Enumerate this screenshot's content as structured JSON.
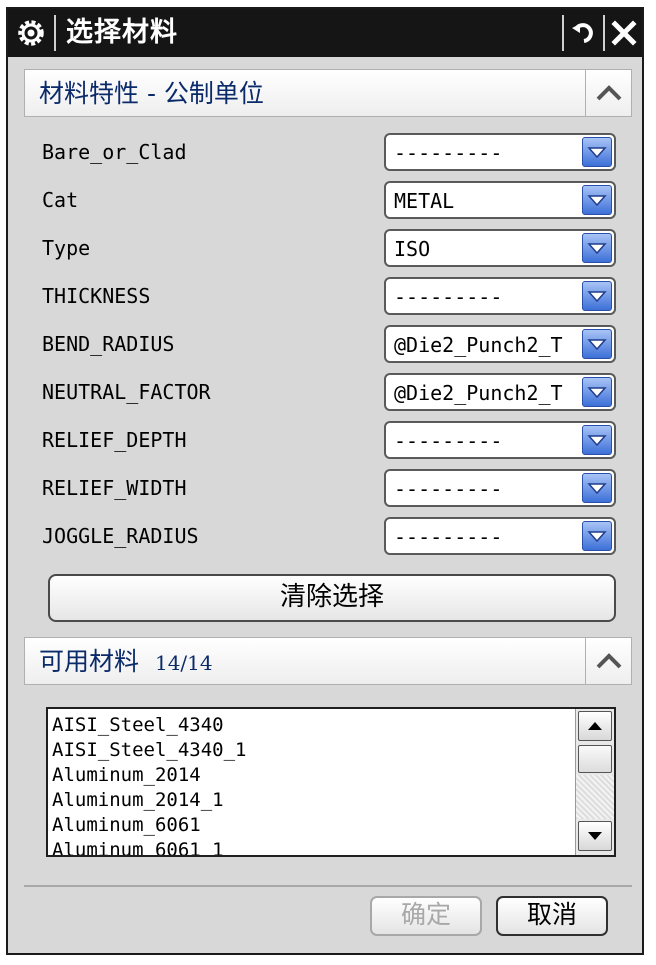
{
  "window": {
    "title": "选择材料",
    "icons": {
      "left": "gear-icon",
      "reset": "reset-icon",
      "close": "close-icon"
    }
  },
  "properties_section": {
    "title": "材料特性 - 公制单位",
    "fields": [
      {
        "label": "Bare_or_Clad",
        "value": "---------"
      },
      {
        "label": "Cat",
        "value": "METAL"
      },
      {
        "label": "Type",
        "value": "ISO"
      },
      {
        "label": "THICKNESS",
        "value": "---------"
      },
      {
        "label": "BEND_RADIUS",
        "value": "@Die2_Punch2_T"
      },
      {
        "label": "NEUTRAL_FACTOR",
        "value": "@Die2_Punch2_T"
      },
      {
        "label": "RELIEF_DEPTH",
        "value": "---------"
      },
      {
        "label": "RELIEF_WIDTH",
        "value": "---------"
      },
      {
        "label": "JOGGLE_RADIUS",
        "value": "---------"
      }
    ],
    "clear_button": "清除选择"
  },
  "materials_section": {
    "title": "可用材料",
    "count": "14/14",
    "items": [
      "AISI_Steel_4340",
      "AISI_Steel_4340_1",
      "Aluminum_2014",
      "Aluminum_2014_1",
      "Aluminum_6061",
      "Aluminum_6061_1"
    ]
  },
  "footer": {
    "ok_label": "确定",
    "cancel_label": "取消"
  },
  "colors": {
    "titlebar": "#151515",
    "dialog_bg": "#d8d8d8",
    "section_title": "#0a2a6a",
    "dropdown_arrow": "#3d6fd7"
  }
}
